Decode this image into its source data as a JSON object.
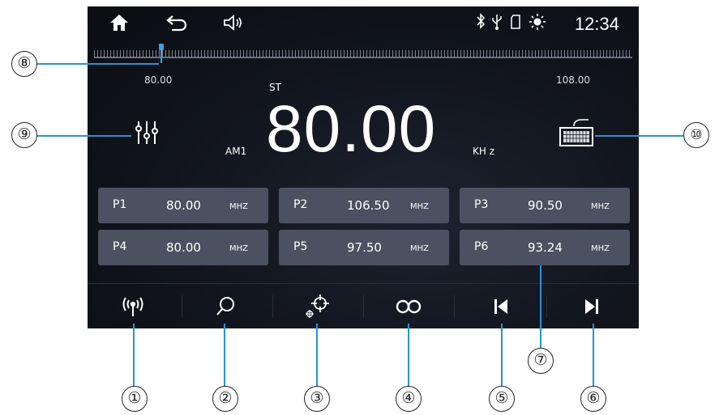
{
  "status": {
    "clock": "12:34"
  },
  "band": {
    "range_min": "80.00",
    "range_max": "108.00",
    "stereo": "ST",
    "band_name": "AM1",
    "frequency": "80.00",
    "unit": "KH z",
    "tuning_position": 0.0
  },
  "presets": [
    {
      "name": "P1",
      "freq": "80.00",
      "unit": "MHZ"
    },
    {
      "name": "P2",
      "freq": "106.50",
      "unit": "MHZ"
    },
    {
      "name": "P3",
      "freq": "90.50",
      "unit": "MHZ"
    },
    {
      "name": "P4",
      "freq": "80.00",
      "unit": "MHZ"
    },
    {
      "name": "P5",
      "freq": "97.50",
      "unit": "MHZ"
    },
    {
      "name": "P6",
      "freq": "93.24",
      "unit": "MHZ"
    }
  ],
  "bottom_icons": [
    "radio-signal-icon",
    "search-icon",
    "location-icon",
    "loop-icon",
    "previous-icon",
    "next-icon"
  ],
  "callouts": {
    "c1": "①",
    "c2": "②",
    "c3": "③",
    "c4": "④",
    "c5": "⑤",
    "c6": "⑥",
    "c7": "⑦",
    "c8": "⑧",
    "c9": "⑨",
    "c10": "⑩"
  },
  "colors": {
    "accent": "#1f97d8",
    "background": "#11141c",
    "preset_bg": "#4b5160"
  }
}
